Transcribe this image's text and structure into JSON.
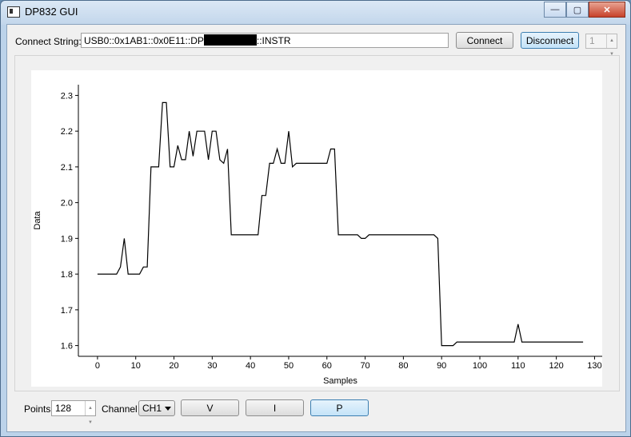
{
  "window": {
    "title": "DP832 GUI",
    "controls": {
      "minimize": "—",
      "maximize": "▢",
      "close": "✕"
    }
  },
  "connection": {
    "label": "Connect String:",
    "value_prefix": "USB0::0x1AB1::0x0E11::DP",
    "value_suffix": "::INSTR",
    "connect_label": "Connect",
    "disconnect_label": "Disconnect",
    "index_value": "1"
  },
  "controls": {
    "points_label": "Points",
    "points_value": "128",
    "channel_label": "Channel",
    "channel_value": "CH1",
    "v_label": "V",
    "i_label": "I",
    "p_label": "P",
    "p_active": true
  },
  "chart_data": {
    "type": "line",
    "title": "",
    "xlabel": "Samples",
    "ylabel": "Data",
    "xlim": [
      -5,
      132
    ],
    "ylim": [
      1.57,
      2.33
    ],
    "xticks": [
      0,
      10,
      20,
      30,
      40,
      50,
      60,
      70,
      80,
      90,
      100,
      110,
      120,
      130
    ],
    "yticks": [
      1.6,
      1.7,
      1.8,
      1.9,
      2.0,
      2.1,
      2.2,
      2.3
    ],
    "grid": false,
    "line_color": "#000000",
    "series": [
      {
        "name": "",
        "x": [
          0,
          1,
          2,
          3,
          4,
          5,
          6,
          7,
          8,
          9,
          10,
          11,
          12,
          13,
          14,
          15,
          16,
          17,
          18,
          19,
          20,
          21,
          22,
          23,
          24,
          25,
          26,
          27,
          28,
          29,
          30,
          31,
          32,
          33,
          34,
          35,
          36,
          37,
          38,
          39,
          40,
          41,
          42,
          43,
          44,
          45,
          46,
          47,
          48,
          49,
          50,
          51,
          52,
          53,
          54,
          55,
          56,
          57,
          58,
          59,
          60,
          61,
          62,
          63,
          64,
          65,
          66,
          67,
          68,
          69,
          70,
          71,
          72,
          73,
          74,
          75,
          76,
          77,
          78,
          79,
          80,
          81,
          82,
          83,
          84,
          85,
          86,
          87,
          88,
          89,
          90,
          91,
          92,
          93,
          94,
          95,
          96,
          97,
          98,
          99,
          100,
          101,
          102,
          103,
          104,
          105,
          106,
          107,
          108,
          109,
          110,
          111,
          112,
          113,
          114,
          115,
          116,
          117,
          118,
          119,
          120,
          121,
          122,
          123,
          124,
          125,
          126,
          127
        ],
        "y": [
          1.8,
          1.8,
          1.8,
          1.8,
          1.8,
          1.8,
          1.82,
          1.9,
          1.8,
          1.8,
          1.8,
          1.8,
          1.82,
          1.82,
          2.1,
          2.1,
          2.1,
          2.28,
          2.28,
          2.1,
          2.1,
          2.16,
          2.12,
          2.12,
          2.2,
          2.13,
          2.2,
          2.2,
          2.2,
          2.12,
          2.2,
          2.2,
          2.12,
          2.11,
          2.15,
          1.91,
          1.91,
          1.91,
          1.91,
          1.91,
          1.91,
          1.91,
          1.91,
          2.02,
          2.02,
          2.11,
          2.11,
          2.15,
          2.11,
          2.11,
          2.2,
          2.1,
          2.11,
          2.11,
          2.11,
          2.11,
          2.11,
          2.11,
          2.11,
          2.11,
          2.11,
          2.15,
          2.15,
          1.91,
          1.91,
          1.91,
          1.91,
          1.91,
          1.91,
          1.9,
          1.9,
          1.91,
          1.91,
          1.91,
          1.91,
          1.91,
          1.91,
          1.91,
          1.91,
          1.91,
          1.91,
          1.91,
          1.91,
          1.91,
          1.91,
          1.91,
          1.91,
          1.91,
          1.91,
          1.9,
          1.6,
          1.6,
          1.6,
          1.6,
          1.61,
          1.61,
          1.61,
          1.61,
          1.61,
          1.61,
          1.61,
          1.61,
          1.61,
          1.61,
          1.61,
          1.61,
          1.61,
          1.61,
          1.61,
          1.61,
          1.66,
          1.61,
          1.61,
          1.61,
          1.61,
          1.61,
          1.61,
          1.61,
          1.61,
          1.61,
          1.61,
          1.61,
          1.61,
          1.61,
          1.61,
          1.61,
          1.61,
          1.61
        ]
      }
    ]
  }
}
